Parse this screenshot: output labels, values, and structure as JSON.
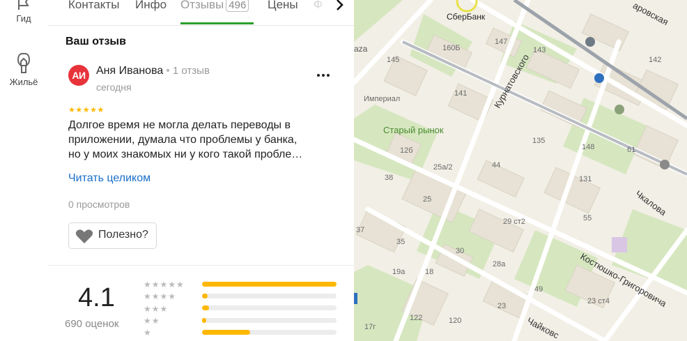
{
  "rail": {
    "items": [
      {
        "label": "Гид",
        "icon": "flag-icon"
      },
      {
        "label": "Жильё",
        "icon": "house-icon"
      }
    ]
  },
  "tabs": [
    {
      "label": "Контакты"
    },
    {
      "label": "Инфо"
    },
    {
      "label": "Отзывы",
      "count": "496",
      "active": true
    },
    {
      "label": "Цены"
    },
    {
      "label": "Ф"
    }
  ],
  "review_section": {
    "title": "Ваш отзыв",
    "avatar_initials": "АИ",
    "author": "Аня Иванова",
    "author_reviews": "1 отзыв",
    "date": "сегодня",
    "stars": "★★★★★",
    "text_lines": [
      "Долгое время не могла делать переводы в",
      "приложении, думала что проблемы у банка,",
      "но у моих знакомых ни у кого такой пробле…"
    ],
    "read_more": "Читать целиком",
    "views": "0 просмотров",
    "useful_label": "Полезно?"
  },
  "rating_summary": {
    "value": "4.1",
    "count_label": "690 оценок",
    "distribution": [
      {
        "stars": "★★★★★",
        "share": 1.0
      },
      {
        "stars": "★★★★",
        "share": 0.04
      },
      {
        "stars": "★★★",
        "share": 0.05
      },
      {
        "stars": "★★",
        "share": 0.03
      },
      {
        "stars": "★",
        "share": 0.36
      }
    ]
  },
  "map": {
    "poi": {
      "sberbank": "СберБанк",
      "market": "Старый рынок",
      "imperial": "Империал"
    },
    "streets": {
      "kurnatovskogo": "Курнатовского",
      "chkalova": "Чкалова",
      "kostyushko": "Костюшко-Григоровича",
      "chaikovskogo": "Чайковс",
      "rovskaya": "аровская"
    },
    "fragments": {
      "aza": "aza"
    },
    "numbers": {
      "n160b": "160Б",
      "n147": "147",
      "n143": "143",
      "n142": "142",
      "n145": "145",
      "n141": "141",
      "n135": "135",
      "n148": "148",
      "n61": "61",
      "n126": "12б",
      "n25a2": "25а/2",
      "n44": "44",
      "n131": "131",
      "n38": "38",
      "n25": "25",
      "n29st2": "29 ст2",
      "n55": "55",
      "n37": "37",
      "n35": "35",
      "n30": "30",
      "n28a": "28а",
      "n19a": "19а",
      "n18": "18",
      "n49": "49",
      "n23st4": "23 ст4",
      "n23": "23",
      "n122": "122",
      "n120": "120",
      "n17g": "17г"
    }
  },
  "colors": {
    "accent_green": "#2aa02a",
    "star": "#ffb800",
    "link": "#1a6fc8",
    "avatar": "#e8333b"
  }
}
